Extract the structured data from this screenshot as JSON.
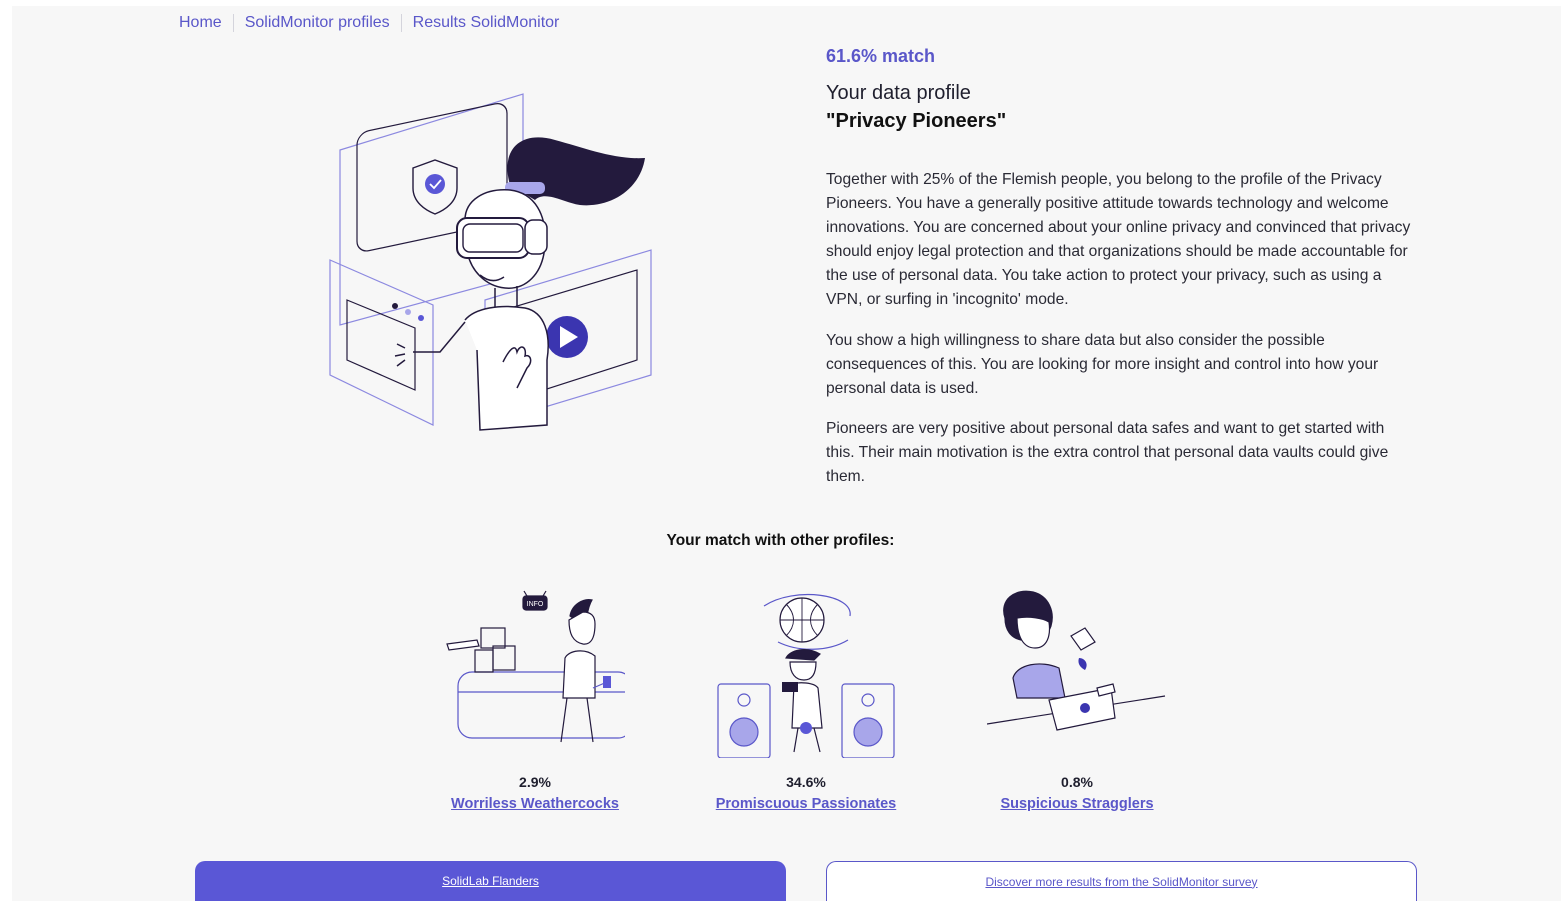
{
  "breadcrumb": {
    "items": [
      "Home",
      "SolidMonitor profiles",
      "Results SolidMonitor"
    ]
  },
  "profile": {
    "match": "61.6% match",
    "label": "Your data profile",
    "name": "\"Privacy Pioneers\"",
    "paragraphs": [
      "Together with 25% of the Flemish people, you belong to the profile of the Privacy Pioneers. You have a generally positive attitude towards technology and welcome innovations. You are concerned about your online privacy and convinced that privacy should enjoy legal protection and that organizations should be made accountable for the use of personal data. You take action to protect your privacy, such as using a VPN, or surfing in 'incognito' mode.",
      "You show a high willingness to share data but also consider the possible consequences of this. You are looking for more insight and control into how your personal data is used.",
      "Pioneers are very positive about personal data safes and want to get started with this. Their main motivation is the extra control that personal data vaults could give them."
    ]
  },
  "others": {
    "title": "Your match with other profiles:",
    "profiles": [
      {
        "pct": "2.9%",
        "name": "Worriless Weathercocks",
        "badge": "INFO"
      },
      {
        "pct": "34.6%",
        "name": "Promiscuous Passionates"
      },
      {
        "pct": "0.8%",
        "name": "Suspicious Stragglers"
      }
    ]
  },
  "buttons": {
    "primary": "SolidLab Flanders",
    "secondary": "Discover more results from the SolidMonitor survey"
  },
  "colors": {
    "accent": "#5a57c9",
    "button": "#5a57d6",
    "dark": "#231a3d",
    "page_bg": "#f7f7f7"
  }
}
